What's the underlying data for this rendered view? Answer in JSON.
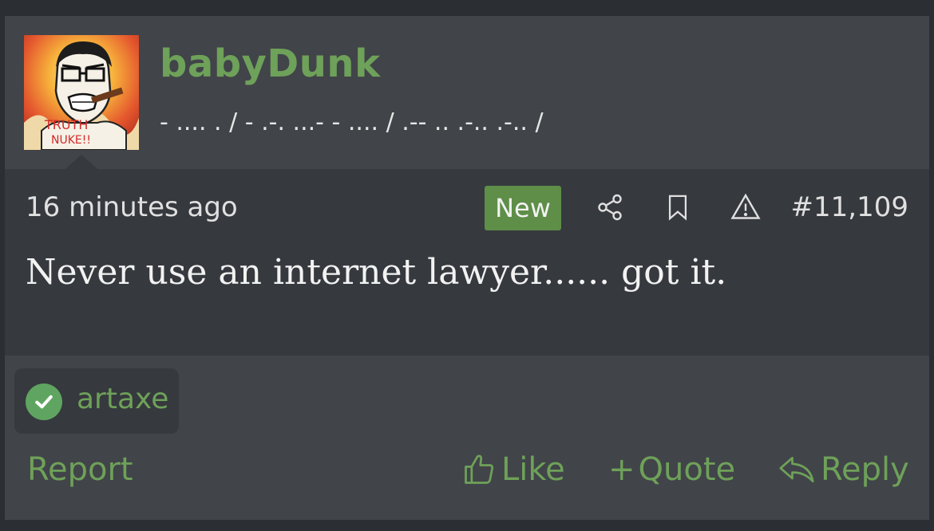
{
  "user": {
    "name": "babyDunk",
    "title": "- .... . / - .-. ...- - .... / .-- .. .-.. .-.. /",
    "avatar_text_top": "TRUTH",
    "avatar_text_bottom": "NUKE!!"
  },
  "post": {
    "time": "16 minutes ago",
    "badge": "New",
    "number": "#11,109",
    "message": "Never use an internet lawyer...... got it."
  },
  "reactions": {
    "users": [
      "artaxe"
    ]
  },
  "actions": {
    "report": "Report",
    "like": "Like",
    "quote": "Quote",
    "reply": "Reply"
  },
  "icons": {
    "share": "share-icon",
    "bookmark": "bookmark-icon",
    "warning": "warning-icon",
    "like": "thumbs-up-icon",
    "quote": "plus-icon",
    "reply": "reply-arrow-icon",
    "reaction": "check-circle-icon"
  },
  "colors": {
    "accent": "#6ea159",
    "badge": "#5e8e48",
    "background": "#414449",
    "body_background": "#36393e"
  }
}
